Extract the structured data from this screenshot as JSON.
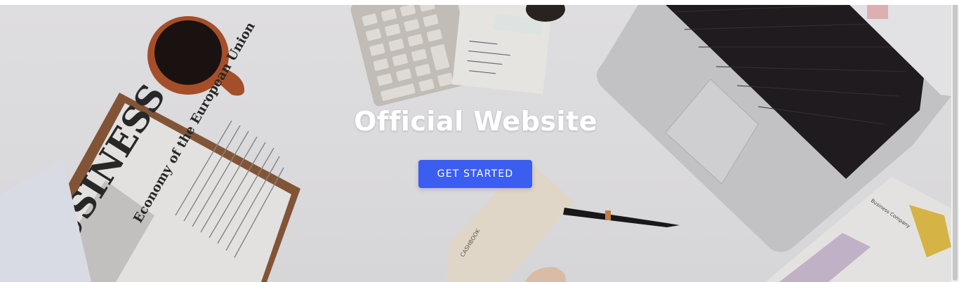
{
  "hero": {
    "title": "Official Website",
    "cta_label": "GET STARTED",
    "accent_color": "#3b5df0"
  },
  "background_photo": {
    "newspaper_headline": "BUSINESS",
    "newspaper_subhead": "Economy of the European Union",
    "notebook_label": "CASHBOOK",
    "document_title": "Business Company"
  }
}
